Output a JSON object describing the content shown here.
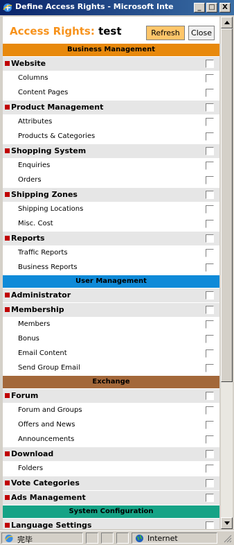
{
  "window": {
    "title": "Define Access Rights - Microsoft Internet...",
    "minimize_label": "_",
    "maximize_label": "□",
    "close_label": "X"
  },
  "header": {
    "prefix": "Access Rights: ",
    "user": "test",
    "refresh_label": "Refresh",
    "close_label": "Close"
  },
  "sections": [
    {
      "title": "Business Management",
      "color": "#e8890c",
      "groups": [
        {
          "label": "Website",
          "children": [
            "Columns",
            "Content Pages"
          ]
        },
        {
          "label": "Product Management",
          "children": [
            "Attributes",
            "Products & Categories"
          ]
        },
        {
          "label": "Shopping System",
          "children": [
            "Enquiries",
            "Orders"
          ]
        },
        {
          "label": "Shipping Zones",
          "children": [
            "Shipping Locations",
            "Misc. Cost"
          ]
        },
        {
          "label": "Reports",
          "children": [
            "Traffic Reports",
            "Business Reports"
          ]
        }
      ]
    },
    {
      "title": "User Management",
      "color": "#0f8ad8",
      "groups": [
        {
          "label": "Administrator",
          "children": []
        },
        {
          "label": "Membership",
          "children": [
            "Members",
            "Bonus",
            "Email Content",
            "Send Group Email"
          ]
        }
      ]
    },
    {
      "title": "Exchange",
      "color": "#a3683a",
      "groups": [
        {
          "label": "Forum",
          "children": [
            "Forum and Groups",
            "Offers and News",
            "Announcements"
          ]
        },
        {
          "label": "Download",
          "children": [
            "Folders"
          ]
        },
        {
          "label": "Vote Categories",
          "children": []
        },
        {
          "label": "Ads Management",
          "children": []
        }
      ]
    },
    {
      "title": "System Configuration",
      "color": "#16a386",
      "groups": [
        {
          "label": "Language Settings",
          "children": []
        }
      ]
    }
  ],
  "status": {
    "text": "完毕",
    "zone": "Internet"
  }
}
